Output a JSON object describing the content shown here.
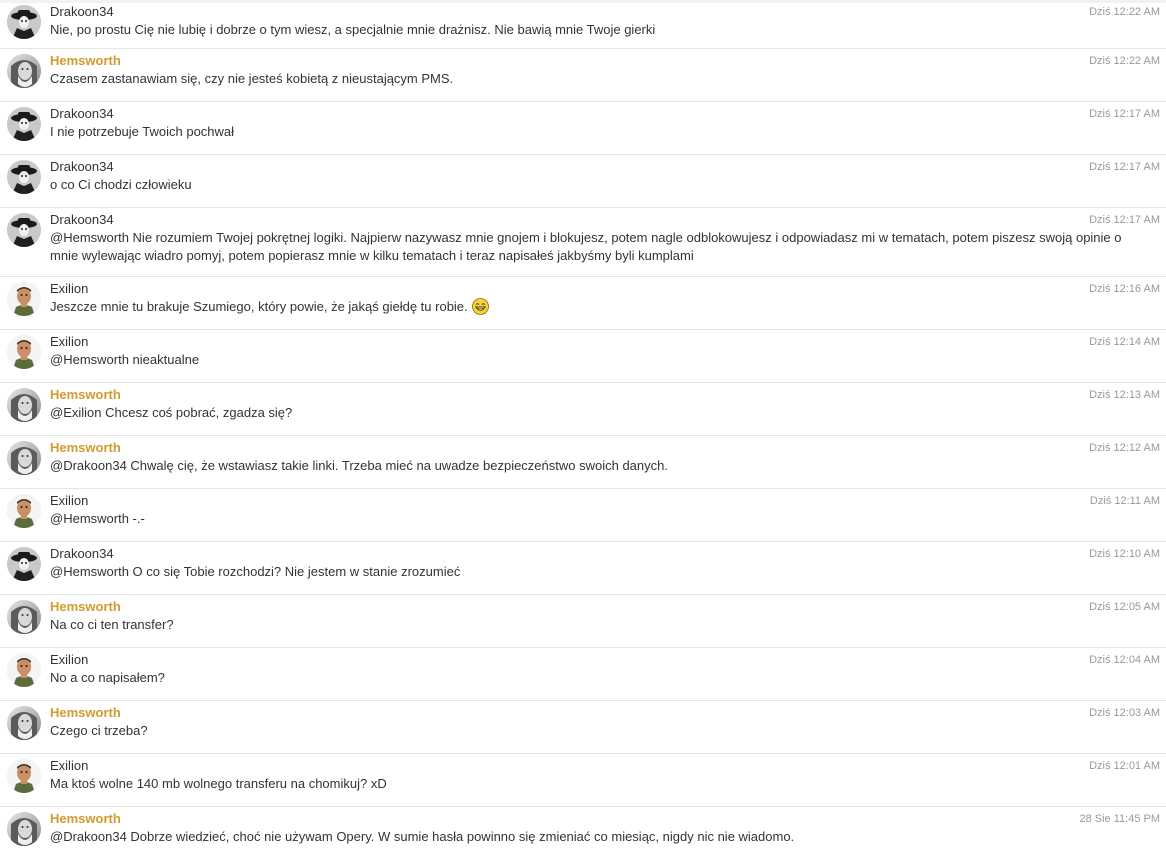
{
  "messages": [
    {
      "user": "Drakoon34",
      "avatar": "drakoon-avatar",
      "highlight": false,
      "time": "Dziś 12:22 AM",
      "text": "Nie, po prostu Cię nie lubię i dobrze o tym wiesz, a specjalnie mnie drażnisz. Nie bawią mnie Twoje gierki"
    },
    {
      "user": "Hemsworth",
      "avatar": "hemsworth-avatar",
      "highlight": true,
      "time": "Dziś 12:22 AM",
      "text": "Czasem zastanawiam się, czy nie jesteś kobietą z nieustającym PMS."
    },
    {
      "user": "Drakoon34",
      "avatar": "drakoon-avatar",
      "highlight": false,
      "time": "Dziś 12:17 AM",
      "text": "I nie potrzebuje Twoich pochwał"
    },
    {
      "user": "Drakoon34",
      "avatar": "drakoon-avatar",
      "highlight": false,
      "time": "Dziś 12:17 AM",
      "text": "o co Ci chodzi człowieku"
    },
    {
      "user": "Drakoon34",
      "avatar": "drakoon-avatar",
      "highlight": false,
      "time": "Dziś 12:17 AM",
      "text": "@Hemsworth Nie rozumiem Twojej pokrętnej logiki. Najpierw nazywasz mnie gnojem i blokujesz, potem nagle odblokowujesz i odpowiadasz mi w tematach, potem piszesz swoją opinie o mnie wylewając wiadro pomyj, potem popierasz mnie w kilku tematach i teraz napisałeś jakbyśmy byli kumplami"
    },
    {
      "user": "Exilion",
      "avatar": "exilion-avatar",
      "highlight": false,
      "time": "Dziś 12:16 AM",
      "text": "Jeszcze mnie tu brakuje Szumiego, który powie, że jakąś giełdę tu robie.",
      "emoji": "grin-emoji"
    },
    {
      "user": "Exilion",
      "avatar": "exilion-avatar",
      "highlight": false,
      "time": "Dziś 12:14 AM",
      "text": "@Hemsworth nieaktualne"
    },
    {
      "user": "Hemsworth",
      "avatar": "hemsworth-avatar",
      "highlight": true,
      "time": "Dziś 12:13 AM",
      "text": "@Exilion Chcesz coś pobrać, zgadza się?"
    },
    {
      "user": "Hemsworth",
      "avatar": "hemsworth-avatar",
      "highlight": true,
      "time": "Dziś 12:12 AM",
      "text": "@Drakoon34 Chwalę cię, że wstawiasz takie linki. Trzeba mieć na uwadze bezpieczeństwo swoich danych."
    },
    {
      "user": "Exilion",
      "avatar": "exilion-avatar",
      "highlight": false,
      "time": "Dziś 12:11 AM",
      "text": "@Hemsworth -.-"
    },
    {
      "user": "Drakoon34",
      "avatar": "drakoon-avatar",
      "highlight": false,
      "time": "Dziś 12:10 AM",
      "text": "@Hemsworth O co się Tobie rozchodzi? Nie jestem w stanie zrozumieć"
    },
    {
      "user": "Hemsworth",
      "avatar": "hemsworth-avatar",
      "highlight": true,
      "time": "Dziś 12:05 AM",
      "text": "Na co ci ten transfer?"
    },
    {
      "user": "Exilion",
      "avatar": "exilion-avatar",
      "highlight": false,
      "time": "Dziś 12:04 AM",
      "text": "No a co napisałem?"
    },
    {
      "user": "Hemsworth",
      "avatar": "hemsworth-avatar",
      "highlight": true,
      "time": "Dziś 12:03 AM",
      "text": "Czego ci trzeba?"
    },
    {
      "user": "Exilion",
      "avatar": "exilion-avatar",
      "highlight": false,
      "time": "Dziś 12:01 AM",
      "text": "Ma ktoś wolne 140 mb wolnego transferu na chomikuj? xD"
    },
    {
      "user": "Hemsworth",
      "avatar": "hemsworth-avatar",
      "highlight": true,
      "time": "28 Sie 11:45 PM",
      "text": "@Drakoon34 Dobrze wiedzieć, choć nie używam Opery. W sumie hasła powinno się zmieniać co miesiąc, nigdy nic nie wiadomo."
    }
  ]
}
